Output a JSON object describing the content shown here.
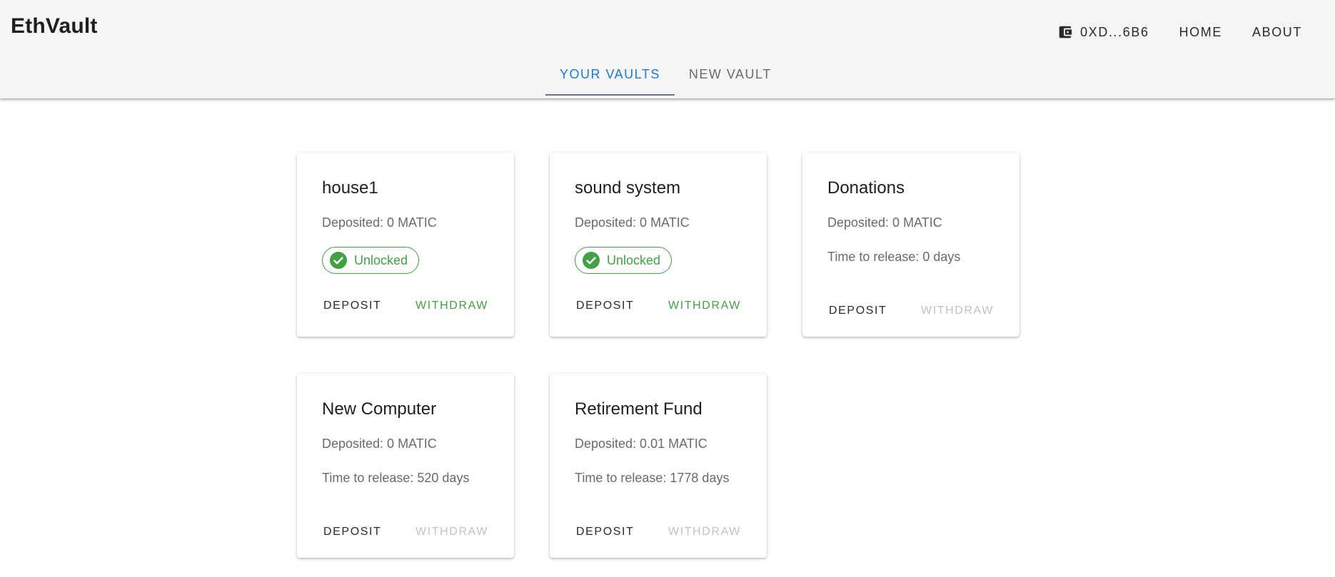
{
  "app": {
    "brand": "EthVault",
    "wallet_address": "0XD...6B6",
    "nav": {
      "home": "HOME",
      "about": "ABOUT"
    }
  },
  "tabs": [
    {
      "label": "YOUR VAULTS",
      "active": true
    },
    {
      "label": "NEW VAULT",
      "active": false
    }
  ],
  "colors": {
    "accent": "#1e7bd6",
    "success": "#43a047",
    "disabled": "#c2c2c2",
    "appbar": "#f5f5f5"
  },
  "vaults": [
    {
      "name": "house1",
      "deposited": "Deposited: 0 MATIC",
      "status": "Unlocked",
      "release": null,
      "deposit_label": "DEPOSIT",
      "withdraw_label": "WITHDRAW",
      "withdraw_enabled": true
    },
    {
      "name": "sound system",
      "deposited": "Deposited: 0 MATIC",
      "status": "Unlocked",
      "release": null,
      "deposit_label": "DEPOSIT",
      "withdraw_label": "WITHDRAW",
      "withdraw_enabled": true
    },
    {
      "name": "Donations",
      "deposited": "Deposited: 0 MATIC",
      "status": null,
      "release": "Time to release: 0 days",
      "deposit_label": "DEPOSIT",
      "withdraw_label": "WITHDRAW",
      "withdraw_enabled": false
    },
    {
      "name": "New Computer",
      "deposited": "Deposited: 0 MATIC",
      "status": null,
      "release": "Time to release: 520 days",
      "deposit_label": "DEPOSIT",
      "withdraw_label": "WITHDRAW",
      "withdraw_enabled": false
    },
    {
      "name": "Retirement Fund",
      "deposited": "Deposited: 0.01 MATIC",
      "status": null,
      "release": "Time to release: 1778 days",
      "deposit_label": "DEPOSIT",
      "withdraw_label": "WITHDRAW",
      "withdraw_enabled": false
    }
  ]
}
